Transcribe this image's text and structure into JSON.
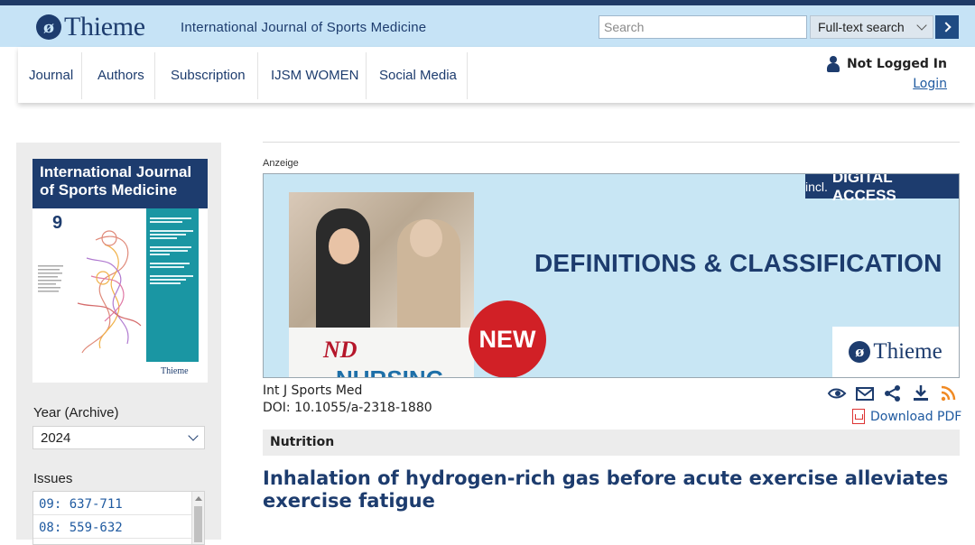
{
  "header": {
    "logo_text": "Thieme",
    "journal_title": "International Journal of Sports Medicine",
    "search_placeholder": "Search",
    "search_mode": "Full-text search"
  },
  "nav": {
    "items": [
      {
        "label": "Journal"
      },
      {
        "label": "Authors"
      },
      {
        "label": "Subscription"
      },
      {
        "label": "IJSM WOMEN"
      },
      {
        "label": "Social Media"
      }
    ],
    "user_status": "Not Logged In",
    "login_label": "Login"
  },
  "sidebar": {
    "cover_title": "International Journal of Sports Medicine",
    "cover_issue_number": "9",
    "cover_publisher": "Thieme",
    "year_label": "Year (Archive)",
    "year_value": "2024",
    "issues_label": "Issues",
    "issues": [
      {
        "label": "09: 637-711"
      },
      {
        "label": "08: 559-632"
      }
    ]
  },
  "ad": {
    "label": "Anzeige",
    "badge_small": "incl.",
    "badge_large": "DIGITAL ACCESS",
    "headline": "DEFINITIONS & CLASSIFICATION",
    "book_logo": "ND",
    "book_title": "NURSING",
    "new_badge": "NEW",
    "brand": "Thieme"
  },
  "article": {
    "journal_abbrev": "Int J Sports Med",
    "doi": "DOI: 10.1055/a-2318-1880",
    "download_pdf": "Download PDF",
    "section": "Nutrition",
    "title": "Inhalation of hydrogen-rich gas before acute exercise alleviates exercise fatigue"
  },
  "colors": {
    "brand_navy": "#1d3c6e",
    "header_bg": "#c6e3f6",
    "link_blue": "#1f5aa0",
    "new_red": "#d12026",
    "rss_orange": "#f08a24"
  },
  "icons": [
    "user-icon",
    "cite-icon",
    "email-icon",
    "share-icon",
    "download-icon",
    "rss-icon",
    "pdf-icon",
    "chevron-down-icon",
    "arrow-right-icon"
  ]
}
